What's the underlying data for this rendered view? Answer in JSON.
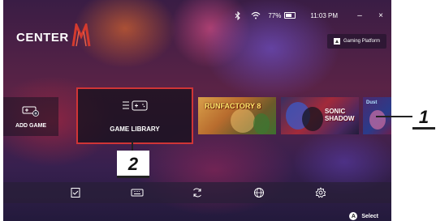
{
  "status": {
    "battery": "77%",
    "time": "11:03 PM",
    "minimize": "–",
    "close": "×"
  },
  "logo": {
    "text": "CENTER",
    "mark": "M"
  },
  "header": {
    "gaming_platform": "Gaming Platform"
  },
  "tiles": {
    "add_game": "ADD GAME",
    "game_library": "GAME LIBRARY",
    "games": [
      {
        "title": "RUNFACTORY 8",
        "subtitle": ""
      },
      {
        "title": "SONIC SHADOW",
        "subtitle": ""
      },
      {
        "title": "Dust",
        "subtitle": ""
      }
    ]
  },
  "bottom_bar": {
    "icons": [
      "checklist-icon",
      "keyboard-icon",
      "refresh-icon",
      "globe-icon",
      "gear-icon"
    ]
  },
  "hint": {
    "button": "A",
    "label": "Select"
  },
  "callouts": [
    "1",
    "2"
  ],
  "colors": {
    "accent": "#d03536"
  }
}
